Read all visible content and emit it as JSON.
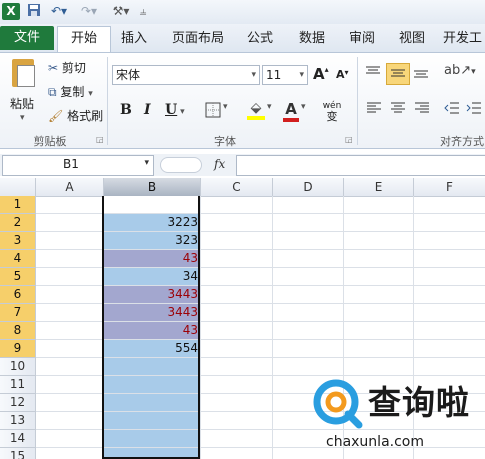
{
  "qat": {
    "excel_icon": "excel-icon",
    "save_icon": "save-icon",
    "undo_icon": "undo-icon",
    "redo_icon": "redo-icon",
    "custom_icon": "wrench-icon"
  },
  "tabs": [
    "文件",
    "开始",
    "插入",
    "页面布局",
    "公式",
    "数据",
    "审阅",
    "视图",
    "开发工"
  ],
  "active_tab": "开始",
  "ribbon": {
    "clipboard": {
      "paste": "粘贴",
      "cut": "剪切",
      "copy": "复制",
      "format_painter": "格式刷",
      "group_label": "剪贴板"
    },
    "font": {
      "font_name": "宋体",
      "font_size": "11",
      "bold": "B",
      "italic": "I",
      "underline": "U",
      "increase_size": "A",
      "decrease_size": "A",
      "font_color_letter": "A",
      "phonetic": "wén",
      "group_label": "字体"
    },
    "alignment": {
      "group_label": "对齐方式"
    }
  },
  "formula_bar": {
    "name_box": "B1",
    "fx": "fx",
    "value": ""
  },
  "columns": [
    "A",
    "B",
    "C",
    "D",
    "E",
    "F"
  ],
  "selected_column": "B",
  "rows": [
    "1",
    "2",
    "3",
    "4",
    "5",
    "6",
    "7",
    "8",
    "9",
    "10",
    "11",
    "12",
    "13",
    "14",
    "15"
  ],
  "column_b_values": [
    "",
    "3223",
    "323",
    "43",
    "34",
    "3443",
    "3443",
    "43",
    "554",
    "",
    "",
    "",
    "",
    "",
    ""
  ],
  "duplicate_flags": [
    false,
    false,
    false,
    true,
    false,
    true,
    true,
    true,
    false,
    false,
    false,
    false,
    false,
    false,
    false
  ],
  "colors": {
    "selection": "#a8cbe9",
    "duplicate_fill": "#a3a7cf",
    "duplicate_text": "#9c0006",
    "file_tab": "#1f7a3c",
    "row_header_selected": "#f6cf6a"
  },
  "watermark": {
    "title": "查询啦",
    "url": "chaxunla.com"
  }
}
